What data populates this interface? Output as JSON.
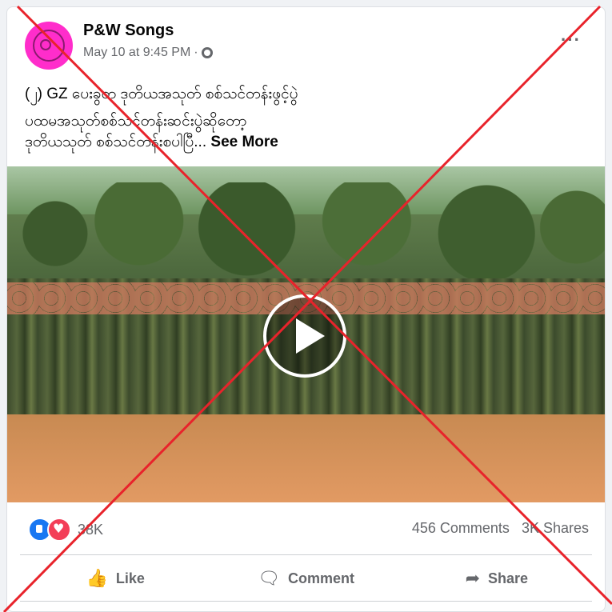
{
  "post": {
    "page_name": "P&W Songs",
    "timestamp": "May 10 at 9:45 PM",
    "separator": "·",
    "audience_icon": "globe-icon",
    "more_icon": "more-options-icon",
    "more_label": "···",
    "caption_line1": "(၂) GZ ပေးခွတ ဒုတိယအသုတ် စစ်သင်တန်းဖွင့်ပွဲ",
    "caption_line2": "ပထမအသုတ်စစ်သင်တန်းဆင်းပွဲဆိုတော့",
    "caption_line3": "ဒုတိယသုတ် စစ်သင်တန်းစပါပြီ...",
    "see_more": "See More"
  },
  "stats": {
    "reaction_icons": [
      "like-icon",
      "love-icon"
    ],
    "reaction_count": "38K",
    "comments": "456 Comments",
    "shares": "3K Shares"
  },
  "actions": {
    "like": "Like",
    "comment": "Comment",
    "share": "Share"
  },
  "overlay": {
    "mark": "red-x-cross",
    "color": "#e8232b"
  },
  "colors": {
    "avatar_bg": "#ff2dcb",
    "text_secondary": "#65676b",
    "like_blue": "#1877f2",
    "love_red": "#f33e58"
  }
}
